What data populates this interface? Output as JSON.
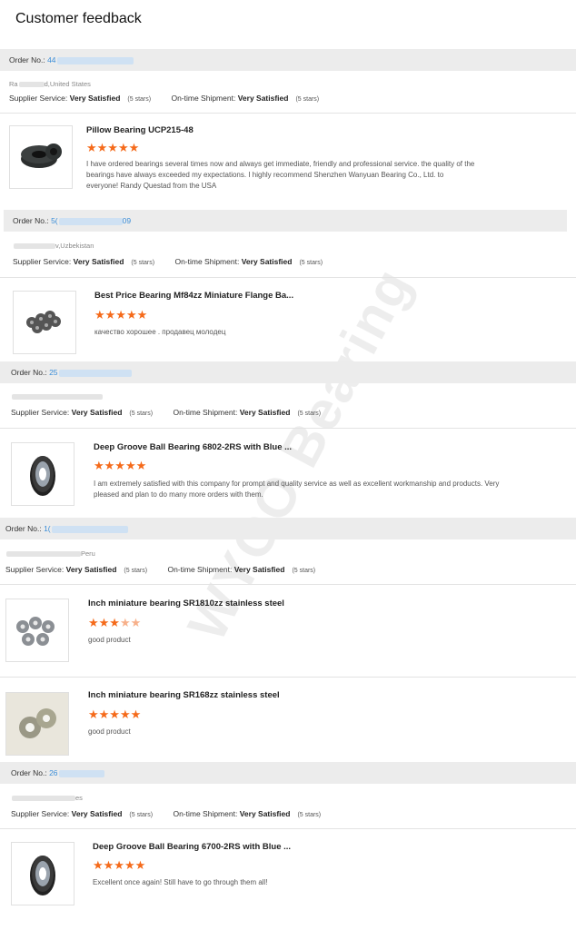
{
  "page": {
    "title": "Customer feedback",
    "watermark": "WYOO Bearing"
  },
  "labels": {
    "order_no": "Order No.:",
    "supplier_service": "Supplier Service:",
    "ontime_shipment": "On-time Shipment:",
    "rating_value": "Very Satisfied",
    "rating_stars": "(5 stars)"
  },
  "colors": {
    "star": "#f56a1a",
    "order_number": "#3a8dd8",
    "order_bar": "#ececec"
  },
  "orders": [
    {
      "order_no": "44",
      "customer": "Ra",
      "customer_loc": "d,United States",
      "products": [
        {
          "title": "Pillow Bearing UCP215-48",
          "stars": 5,
          "review": "I have ordered bearings several times now and always get immediate, friendly and professional service. the quality of the bearings have always exceeded my expectations. I highly recommend Shenzhen Wanyuan Bearing Co., Ltd. to everyone! Randy Questad from the USA"
        }
      ]
    },
    {
      "order_no": "5(",
      "order_no_end": "09",
      "customer": "",
      "customer_loc": "v,Uzbekistan",
      "products": [
        {
          "title": "Best Price Bearing Mf84zz Miniature Flange Ba...",
          "stars": 5,
          "review": "качество хорошее . продавец молодец"
        }
      ]
    },
    {
      "order_no": "25",
      "customer": "",
      "customer_loc": "",
      "products": [
        {
          "title": "Deep Groove Ball Bearing 6802-2RS with Blue ...",
          "stars": 5,
          "review": "I am extremely satisfied with this company for prompt and quality service as well as excellent workmanship and products. Very pleased and plan to do many more orders with them."
        }
      ]
    },
    {
      "order_no": "1(",
      "customer": "",
      "customer_loc": "Peru",
      "products": [
        {
          "title": "Inch miniature bearing SR1810zz stainless steel",
          "stars": 3.5,
          "review": "good product"
        },
        {
          "title": "Inch miniature bearing SR168zz stainless steel",
          "stars": 5,
          "review": "good product"
        }
      ]
    },
    {
      "order_no": "26",
      "customer": "",
      "customer_loc": "es",
      "products": [
        {
          "title": "Deep Groove Ball Bearing 6700-2RS with Blue ...",
          "stars": 5,
          "review": "Excellent once again! Still have to go through them all!"
        }
      ]
    }
  ]
}
